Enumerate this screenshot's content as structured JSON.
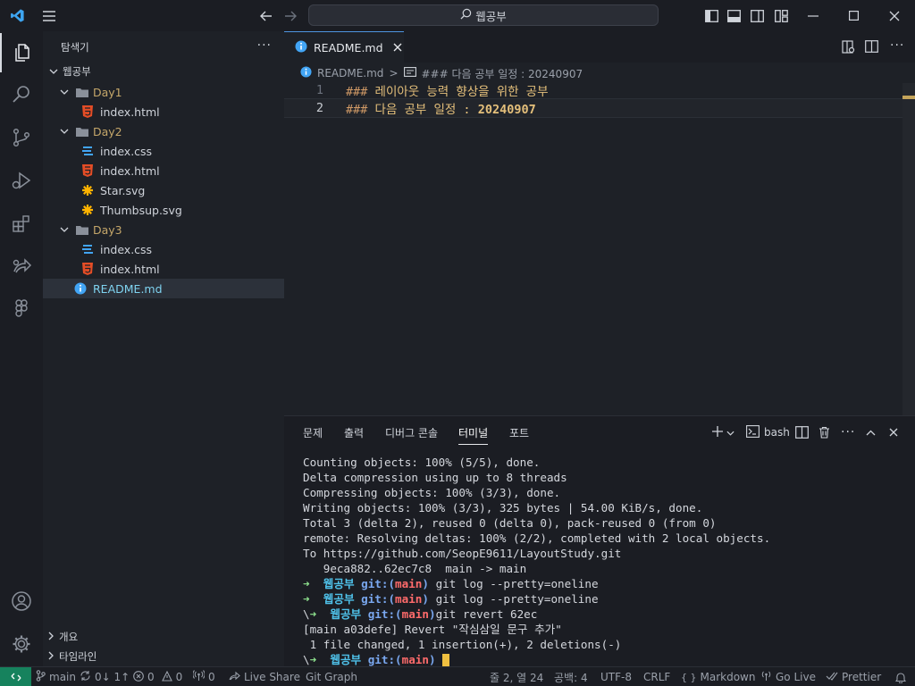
{
  "titlebar": {
    "search_text": "웹공부"
  },
  "sidebar": {
    "title": "탐색기",
    "root": "웹공부",
    "items": [
      {
        "type": "folder",
        "label": "Day1"
      },
      {
        "type": "html",
        "label": "index.html"
      },
      {
        "type": "folder",
        "label": "Day2"
      },
      {
        "type": "css",
        "label": "index.css"
      },
      {
        "type": "html",
        "label": "index.html"
      },
      {
        "type": "svg",
        "label": "Star.svg"
      },
      {
        "type": "svg",
        "label": "Thumbsup.svg"
      },
      {
        "type": "folder",
        "label": "Day3"
      },
      {
        "type": "css",
        "label": "index.css"
      },
      {
        "type": "html",
        "label": "index.html"
      },
      {
        "type": "info",
        "label": "README.md"
      }
    ],
    "sections": [
      "개요",
      "타임라인"
    ]
  },
  "editor": {
    "tab_label": "README.md",
    "breadcrumb": {
      "file": "README.md",
      "separator": ">",
      "symbol": "### 다음 공부 일정 : 20240907"
    },
    "lines": [
      {
        "number": "1",
        "hash": "###",
        "text": "레이아웃 능력 향상을 위한 공부",
        "bold": ""
      },
      {
        "number": "2",
        "hash": "###",
        "text": "다음 공부 일정 : ",
        "bold": "20240907"
      }
    ]
  },
  "panel": {
    "tabs": [
      "문제",
      "출력",
      "디버그 콘솔",
      "터미널",
      "포트"
    ],
    "active_tab": "터미널",
    "shell": "bash",
    "terminal": {
      "plain": [
        "Counting objects: 100% (5/5), done.",
        "Delta compression using up to 8 threads",
        "Compressing objects: 100% (3/3), done.",
        "Writing objects: 100% (3/3), 325 bytes | 54.00 KiB/s, done.",
        "Total 3 (delta 2), reused 0 (delta 0), pack-reused 0 (from 0)",
        "remote: Resolving deltas: 100% (2/2), completed with 2 local objects.",
        "To https://github.com/SeopE9611/LayoutStudy.git",
        "   9eca882..62ec7c8  main -> main"
      ],
      "prompt_dir": "웹공부",
      "prompt_git": "git:(",
      "prompt_branch": "main",
      "prompt_close": ")",
      "cmd1": "git log --pretty=oneline",
      "cmd2": "git log --pretty=oneline",
      "cmd3": "git revert 62ec",
      "revert_out1": "[main a03defe] Revert \"작심삼일 문구 추가\"",
      "revert_out2": " 1 file changed, 1 insertion(+), 2 deletions(-)"
    }
  },
  "statusbar": {
    "branch": "main",
    "sync": "0↓ 1↑",
    "errors": "0",
    "warnings": "0",
    "ports": "0",
    "live_share": "Live Share",
    "git_graph": "Git Graph",
    "position": "줄 2, 열 24",
    "spaces": "공백: 4",
    "encoding": "UTF-8",
    "eol": "CRLF",
    "language": "Markdown",
    "go_live": "Go Live",
    "prettier": "Prettier"
  },
  "colors": {
    "accent": "#4e94e0",
    "remote_bg": "#16825d",
    "heading": "#e5c07b",
    "prompt_arrow": "#8fe38f",
    "branch": "#ff6b6b"
  }
}
